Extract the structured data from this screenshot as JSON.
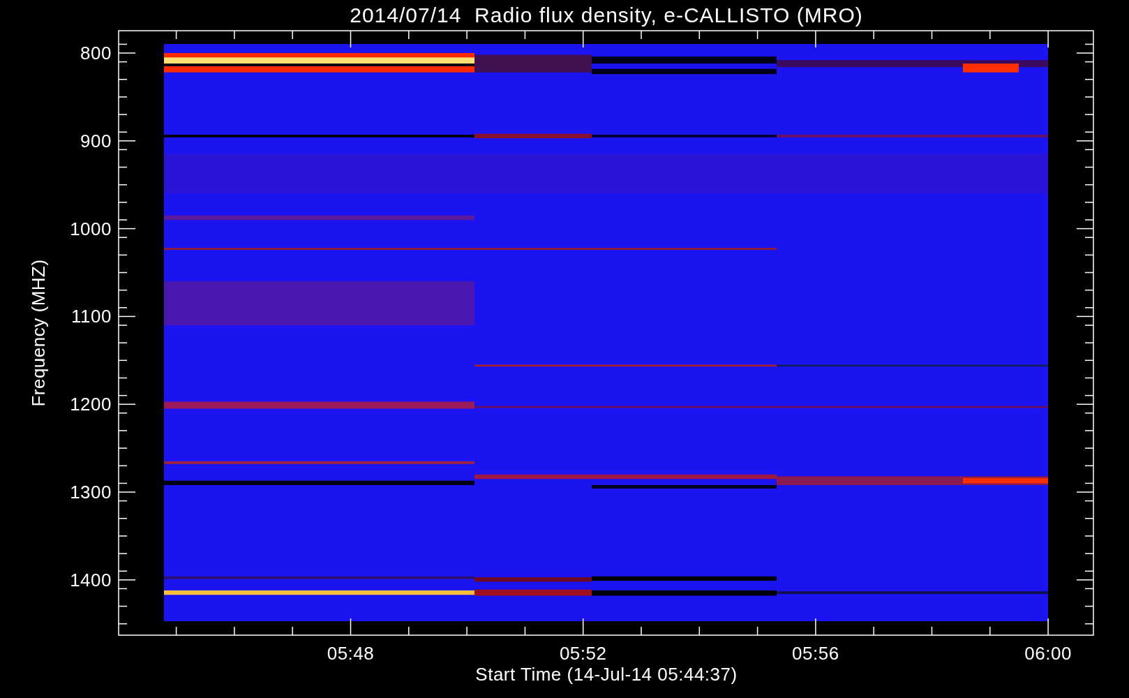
{
  "plot": {
    "title": "2014/07/14  Radio flux density, e-CALLISTO (MRO)",
    "y_label": "Frequency (MHZ)",
    "y_ticks": [
      "800",
      "900",
      "1000",
      "1100",
      "1200",
      "1300",
      "1400"
    ],
    "x_label": "Start Time (14-Jul-14 05:44:37)",
    "x_ticks": [
      "05:48",
      "05:52",
      "05:56",
      "06:00"
    ]
  }
}
